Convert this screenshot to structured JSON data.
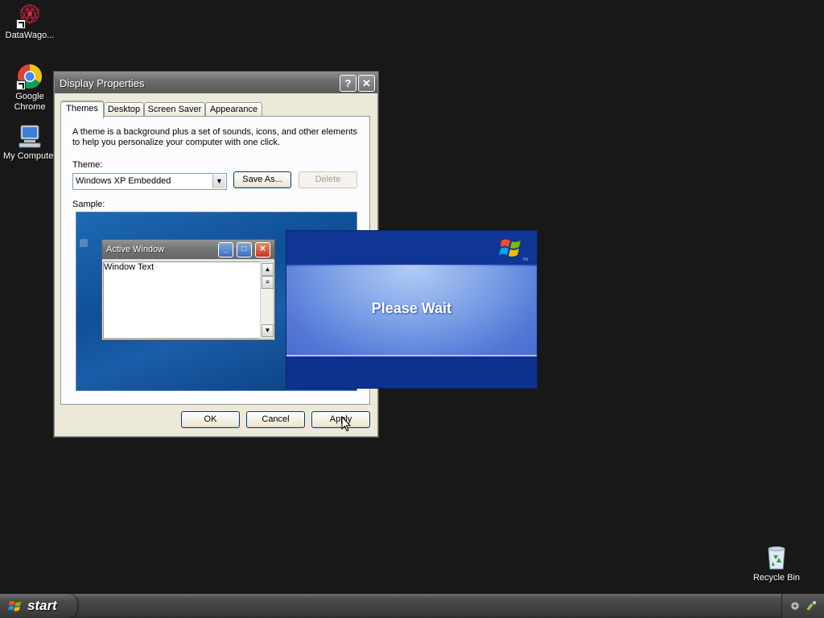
{
  "desktop": {
    "icons": [
      {
        "label": "DataWago...",
        "icon": "datawagon-icon"
      },
      {
        "label": "Google\nChrome",
        "icon": "chrome-icon"
      },
      {
        "label": "My Computer",
        "icon": "my-computer-icon"
      },
      {
        "label": "Recycle Bin",
        "icon": "recycle-bin-icon"
      }
    ]
  },
  "dialog": {
    "title": "Display Properties",
    "help_glyph": "?",
    "close_glyph": "✕",
    "tabs": [
      "Themes",
      "Desktop",
      "Screen Saver",
      "Appearance"
    ],
    "active_tab": "Themes",
    "description": "A theme is a background plus a set of sounds, icons, and other elements to help you personalize your computer with one click.",
    "theme_label": "Theme:",
    "theme_value": "Windows XP Embedded",
    "save_as_label": "Save As...",
    "delete_label": "Delete",
    "sample_label": "Sample:",
    "sample_window": {
      "title": "Active Window",
      "text": "Window Text"
    },
    "ok_label": "OK",
    "cancel_label": "Cancel",
    "apply_label": "Apply"
  },
  "splash": {
    "message": "Please Wait",
    "trademark": "TM"
  },
  "taskbar": {
    "start_label": "start"
  },
  "colors": {
    "splash_blue": "#0c3290",
    "desktop_bg": "#181818"
  }
}
